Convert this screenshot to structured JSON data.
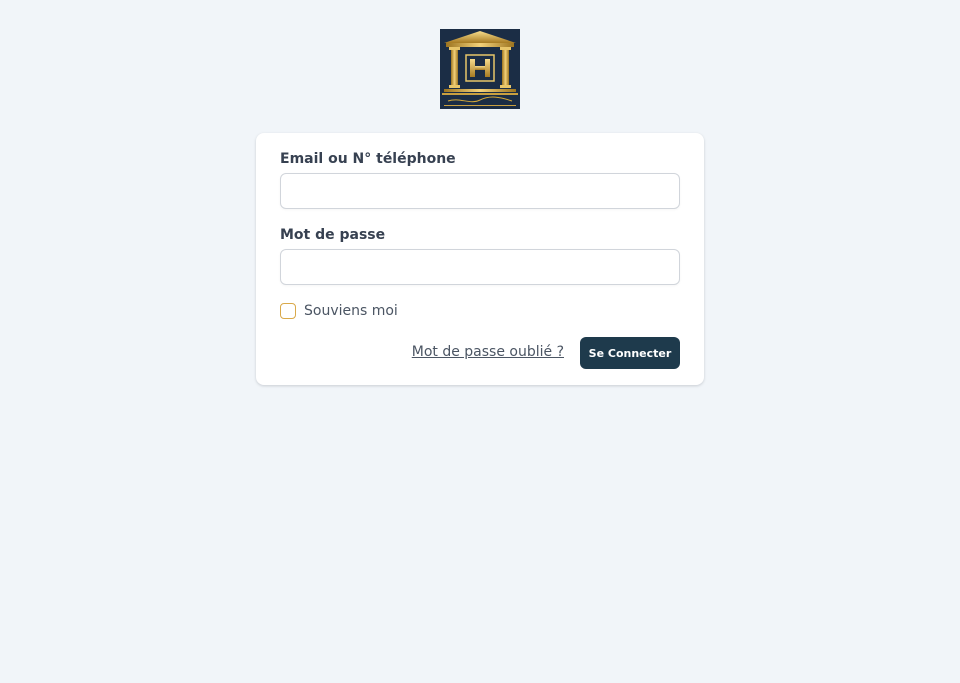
{
  "logo": {
    "icon": "hotel-logo-icon",
    "colors": {
      "background": "#1b2d45",
      "gold": "#d4a93a"
    }
  },
  "form": {
    "email_label": "Email ou N° téléphone",
    "email_value": "",
    "password_label": "Mot de passe",
    "password_value": "",
    "remember_label": "Souviens moi",
    "remember_checked": false,
    "forgot_link": "Mot de passe oublié ?",
    "submit_label": "Se Connecter"
  },
  "colors": {
    "page_background": "#f1f5f9",
    "card_background": "#ffffff",
    "button_background": "#1e3a4c",
    "checkbox_border": "#d9a94a"
  }
}
